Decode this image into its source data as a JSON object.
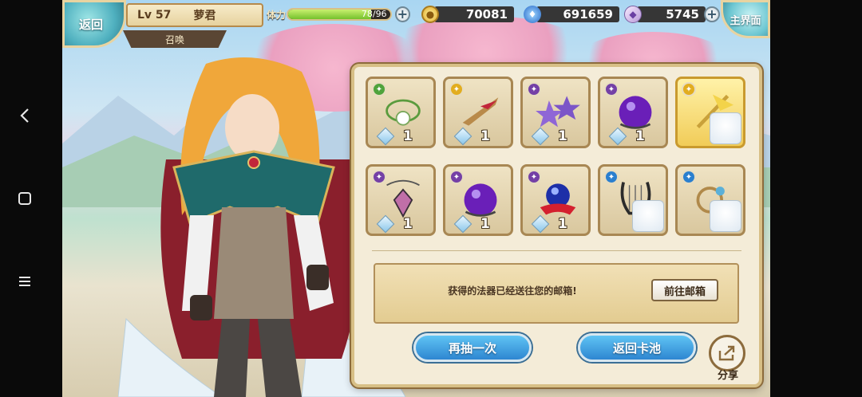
{
  "hud": {
    "back_label": "返回",
    "level": "Lv 57",
    "player_name": "萝君",
    "tab_label": "召唤",
    "stamina_label": "体力",
    "stamina_text": "78/96",
    "stamina_fraction": 0.8125,
    "gold": "70081",
    "gems": "691659",
    "crystals": "5745",
    "main_label": "主界面"
  },
  "items": [
    {
      "badge": "green",
      "frame": "normal",
      "icon": "leaf-necklace-icon",
      "qty": "1"
    },
    {
      "badge": "gold",
      "frame": "normal",
      "icon": "red-blade-icon",
      "qty": "1"
    },
    {
      "badge": "purple",
      "frame": "normal",
      "icon": "star-earrings-icon",
      "qty": "1"
    },
    {
      "badge": "purple",
      "frame": "normal",
      "icon": "purple-orb-icon",
      "qty": "1"
    },
    {
      "badge": "gold",
      "frame": "gold",
      "icon": "golden-staff-icon",
      "qty": ""
    },
    {
      "badge": "purple",
      "frame": "normal",
      "icon": "crystal-pendant-icon",
      "qty": "1"
    },
    {
      "badge": "purple",
      "frame": "normal",
      "icon": "purple-orb-icon",
      "qty": "1"
    },
    {
      "badge": "purple",
      "frame": "normal",
      "icon": "blue-orb-ribbon-icon",
      "qty": "1"
    },
    {
      "badge": "blue",
      "frame": "normal",
      "icon": "dark-lyre-icon",
      "qty": ""
    },
    {
      "badge": "blue",
      "frame": "normal",
      "icon": "golden-ring-icon",
      "qty": ""
    }
  ],
  "message": {
    "text": "获得的法器已经送往您的邮箱!",
    "mail_button": "前往邮箱"
  },
  "actions": {
    "again": "再抽一次",
    "back_to_pool": "返回卡池",
    "share": "分享"
  },
  "colors": {
    "panel_bg": "#f4ecd8",
    "button_blue": "#2e86d1",
    "stamina_green": "#73c12c"
  }
}
